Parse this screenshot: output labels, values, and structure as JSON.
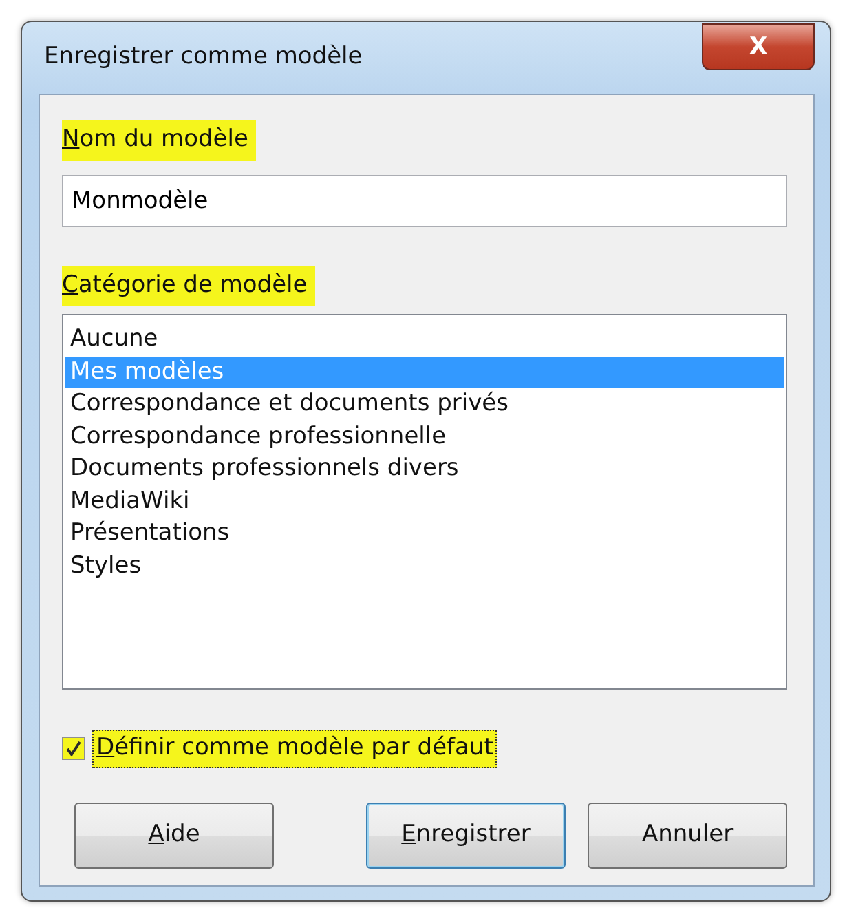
{
  "window": {
    "title": "Enregistrer comme modèle",
    "close_label": "X"
  },
  "name_label": {
    "text": "Nom du modèle",
    "mnemonic": true,
    "highlighted": true
  },
  "name_field": {
    "value": "Monmodèle"
  },
  "category_label": {
    "text": "Catégorie de modèle",
    "mnemonic": true,
    "highlighted": true
  },
  "categories": [
    {
      "label": "Aucune",
      "selected": false
    },
    {
      "label": "Mes modèles",
      "selected": true
    },
    {
      "label": "Correspondance et documents privés",
      "selected": false
    },
    {
      "label": "Correspondance professionnelle",
      "selected": false
    },
    {
      "label": "Documents professionnels divers",
      "selected": false
    },
    {
      "label": "MediaWiki",
      "selected": false
    },
    {
      "label": "Présentations",
      "selected": false
    },
    {
      "label": "Styles",
      "selected": false
    }
  ],
  "default_checkbox": {
    "label": "Définir comme modèle par défaut",
    "checked": true,
    "mnemonic": true,
    "highlighted": true
  },
  "buttons": [
    {
      "label": "Aide",
      "mnemonic": true,
      "default": false
    },
    {
      "label": "Enregistrer",
      "mnemonic": true,
      "default": true
    },
    {
      "label": "Annuler",
      "mnemonic": false,
      "default": false
    }
  ]
}
